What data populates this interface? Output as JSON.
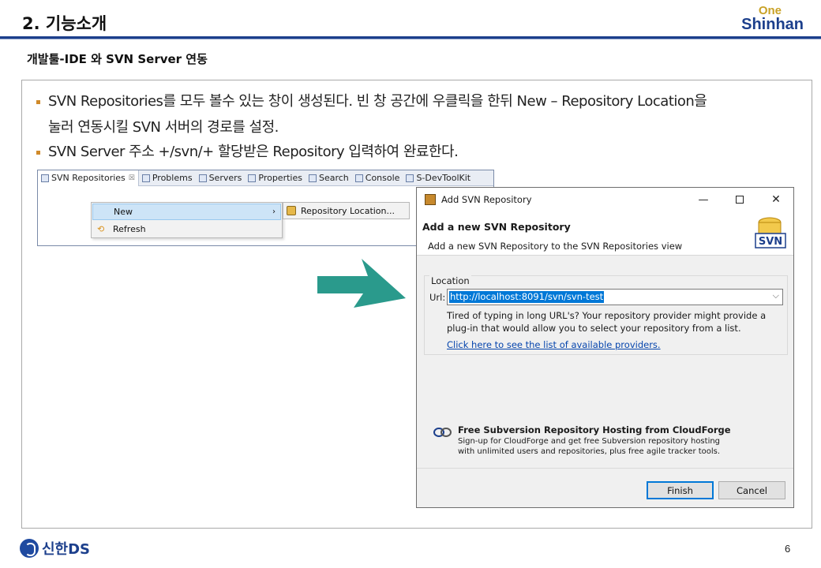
{
  "header": {
    "title": "2. 기능소개",
    "logo_top": "One",
    "logo_bottom": "Shinhan"
  },
  "subtitle": "개발툴-IDE 와 SVN Server 연동",
  "bullets": [
    {
      "line1": "SVN Repositories를 모두 볼수 있는 창이 생성된다. 빈 창 공간에 우클릭을 한뒤 New – Repository Location을",
      "line2": "눌러 연동시킬 SVN 서버의 경로를 설정."
    },
    {
      "line1": "SVN Server 주소 +/svn/+ 할당받은 Repository 입력하여 완료한다."
    }
  ],
  "eclipse": {
    "tabs": [
      {
        "label": "SVN Repositories",
        "icon": "svn-repo-icon"
      },
      {
        "label": "Problems",
        "icon": "problems-icon"
      },
      {
        "label": "Servers",
        "icon": "servers-icon"
      },
      {
        "label": "Properties",
        "icon": "properties-icon"
      },
      {
        "label": "Search",
        "icon": "search-icon"
      },
      {
        "label": "Console",
        "icon": "console-icon"
      },
      {
        "label": "S-DevToolKit",
        "icon": "toolkit-icon"
      }
    ],
    "tab_close": "☒",
    "context_menu": {
      "new_label": "New",
      "new_arrow": "›",
      "refresh_label": "Refresh",
      "submenu_label": "Repository Location..."
    }
  },
  "dialog": {
    "window_title": "Add SVN Repository",
    "header_title": "Add a new SVN Repository",
    "header_desc": "Add a new SVN Repository to the SVN Repositories view",
    "badge_text": "SVN",
    "location_legend": "Location",
    "url_label": "Url:",
    "url_value": "http://localhost:8091/svn/svn-test",
    "hint_text": "Tired of typing in long URL's?  Your repository provider might provide a plug-in that would allow you to select your repository from a list.",
    "providers_link": "Click here to see the list of available providers.",
    "cloudforge_title": "Free Subversion Repository Hosting from CloudForge",
    "cloudforge_desc1": "Sign-up for CloudForge and get free Subversion repository hosting",
    "cloudforge_desc2": "with unlimited users and repositories, plus free agile tracker tools.",
    "finish_label": "Finish",
    "cancel_label": "Cancel"
  },
  "footer": {
    "brand": "신한DS",
    "page_number": "6"
  },
  "colors": {
    "brand_blue": "#1c3f8c",
    "brand_gold": "#c9a227",
    "arrow_teal": "#2a9a8c",
    "bullet_orange": "#d08a2a",
    "selection_blue": "#0078d7"
  }
}
